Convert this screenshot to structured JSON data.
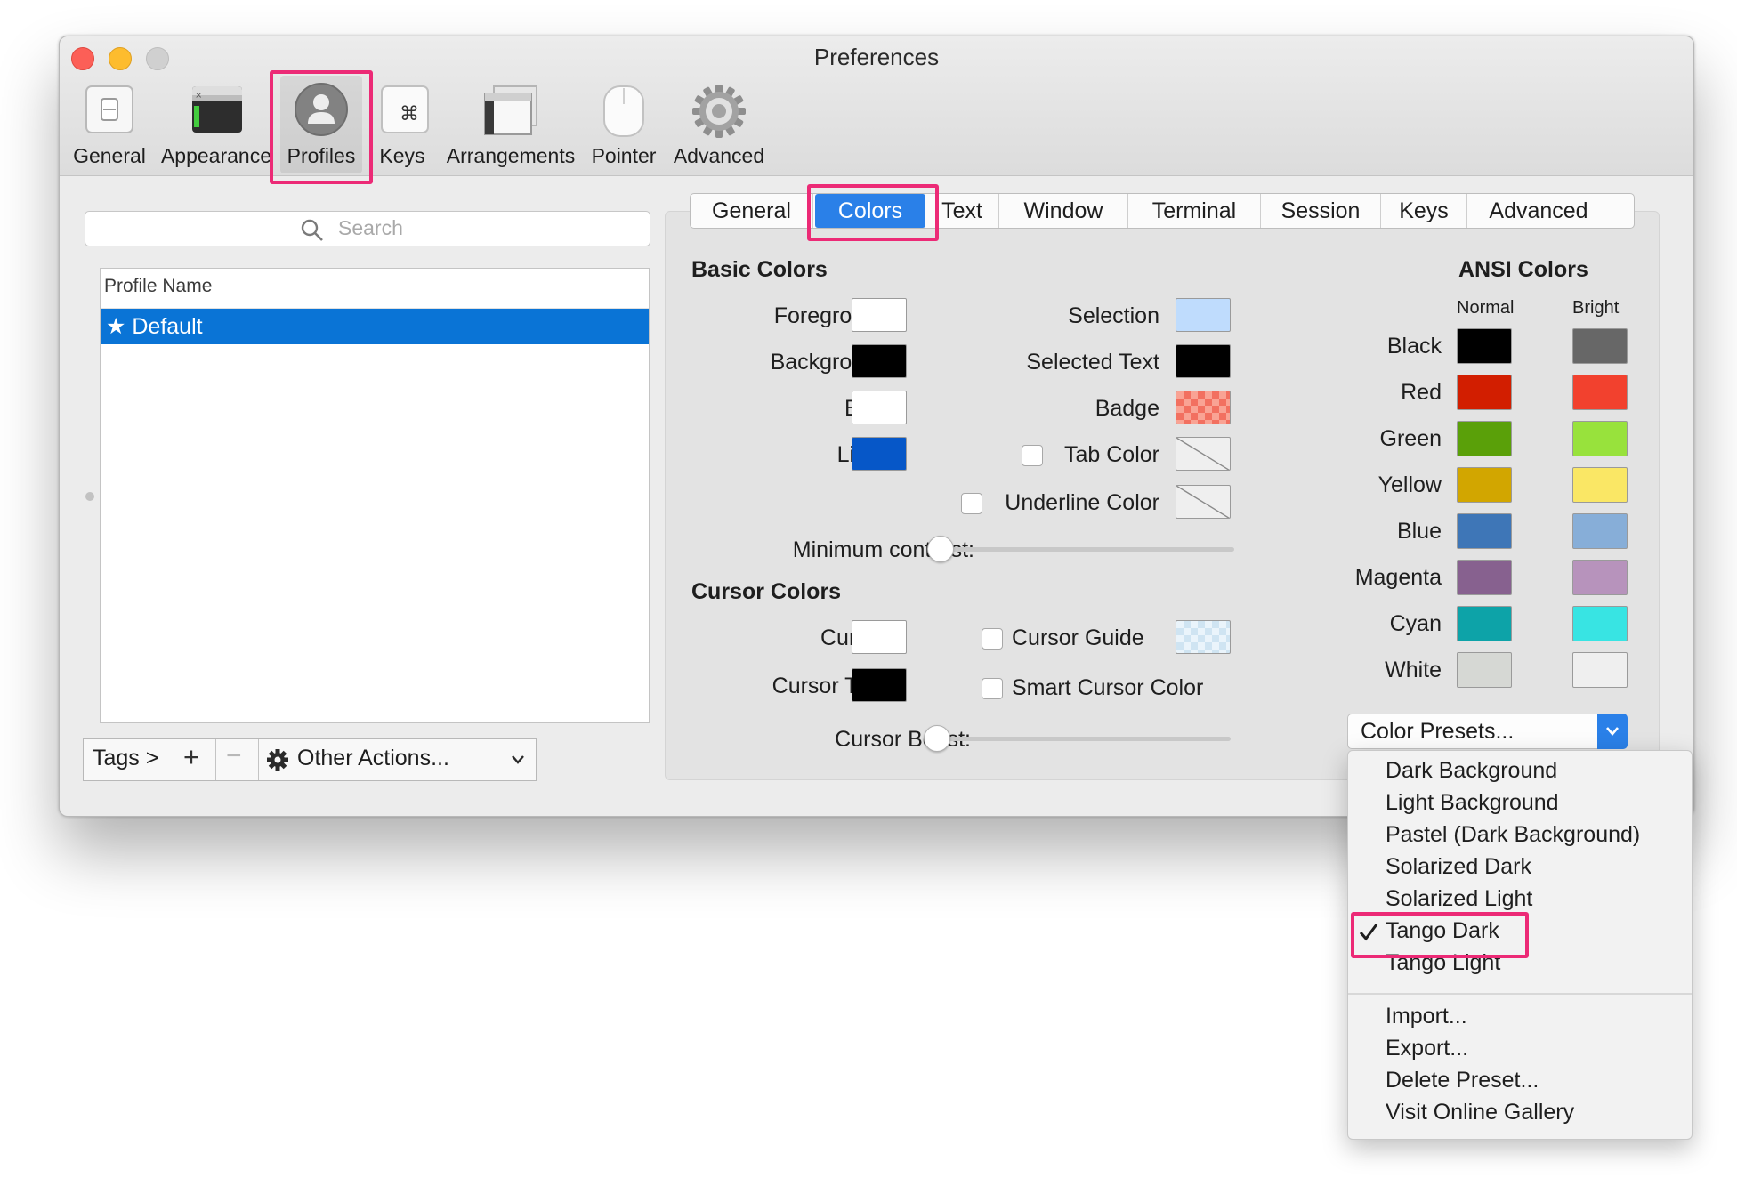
{
  "window": {
    "title": "Preferences"
  },
  "toolbar": {
    "items": [
      {
        "label": "General",
        "icon": "general-switch-icon"
      },
      {
        "label": "Appearance",
        "icon": "appearance-window-icon"
      },
      {
        "label": "Profiles",
        "icon": "profiles-person-icon",
        "selected": true
      },
      {
        "label": "Keys",
        "icon": "command-key-icon"
      },
      {
        "label": "Arrangements",
        "icon": "arrangements-icon"
      },
      {
        "label": "Pointer",
        "icon": "mouse-icon"
      },
      {
        "label": "Advanced",
        "icon": "gear-icon"
      }
    ]
  },
  "profiles": {
    "search_placeholder": "Search",
    "column_header": "Profile Name",
    "rows": [
      {
        "label": "★ Default",
        "selected": true
      }
    ],
    "tags_label": "Tags >",
    "add_label": "+",
    "remove_label": "−",
    "other_actions_label": "Other Actions..."
  },
  "tabs": [
    "General",
    "Colors",
    "Text",
    "Window",
    "Terminal",
    "Session",
    "Keys",
    "Advanced"
  ],
  "active_tab": "Colors",
  "basic_colors": {
    "heading": "Basic Colors",
    "left": [
      {
        "label": "Foreground",
        "color": "#ffffff"
      },
      {
        "label": "Background",
        "color": "#000000"
      },
      {
        "label": "Bold",
        "color": "#ffffff"
      },
      {
        "label": "Links",
        "color": "#0657c8"
      }
    ],
    "right": [
      {
        "label": "Selection",
        "color": "#bfdcfd"
      },
      {
        "label": "Selected Text",
        "color": "#000000"
      },
      {
        "label": "Badge",
        "color": "#f5806c"
      },
      {
        "label": "Tab Color",
        "color": "none",
        "checkbox": true
      },
      {
        "label": "Underline Color",
        "color": "none",
        "checkbox": true
      }
    ],
    "min_contrast_label": "Minimum contrast:",
    "min_contrast_value": 0
  },
  "cursor_colors": {
    "heading": "Cursor Colors",
    "left": [
      {
        "label": "Cursor",
        "color": "#ffffff"
      },
      {
        "label": "Cursor Text",
        "color": "#000000"
      }
    ],
    "cursor_guide_label": "Cursor Guide",
    "smart_cursor_label": "Smart Cursor Color",
    "cursor_boost_label": "Cursor Boost:",
    "cursor_boost_value": 0
  },
  "ansi": {
    "heading": "ANSI Colors",
    "normal_label": "Normal",
    "bright_label": "Bright",
    "rows": [
      {
        "label": "Black",
        "normal": "#000000",
        "bright": "#676767"
      },
      {
        "label": "Red",
        "normal": "#d21e00",
        "bright": "#f2412e"
      },
      {
        "label": "Green",
        "normal": "#5aa009",
        "bright": "#98e23c"
      },
      {
        "label": "Yellow",
        "normal": "#d2a600",
        "bright": "#fae765"
      },
      {
        "label": "Blue",
        "normal": "#3e76b7",
        "bright": "#87aed8"
      },
      {
        "label": "Magenta",
        "normal": "#87618f",
        "bright": "#b793bc"
      },
      {
        "label": "Cyan",
        "normal": "#0da3a8",
        "bright": "#38e4e3"
      },
      {
        "label": "White",
        "normal": "#d6d8d4",
        "bright": "#efefef"
      }
    ]
  },
  "presets": {
    "button_label": "Color Presets...",
    "items": [
      "Dark Background",
      "Light Background",
      "Pastel (Dark Background)",
      "Solarized Dark",
      "Solarized Light",
      "Tango Dark",
      "Tango Light"
    ],
    "checked": "Tango Dark",
    "actions": [
      "Import...",
      "Export...",
      "Delete Preset...",
      "Visit Online Gallery"
    ]
  },
  "colors": {
    "accent": "#0a74d6",
    "highlight_box": "#ec2a76"
  }
}
